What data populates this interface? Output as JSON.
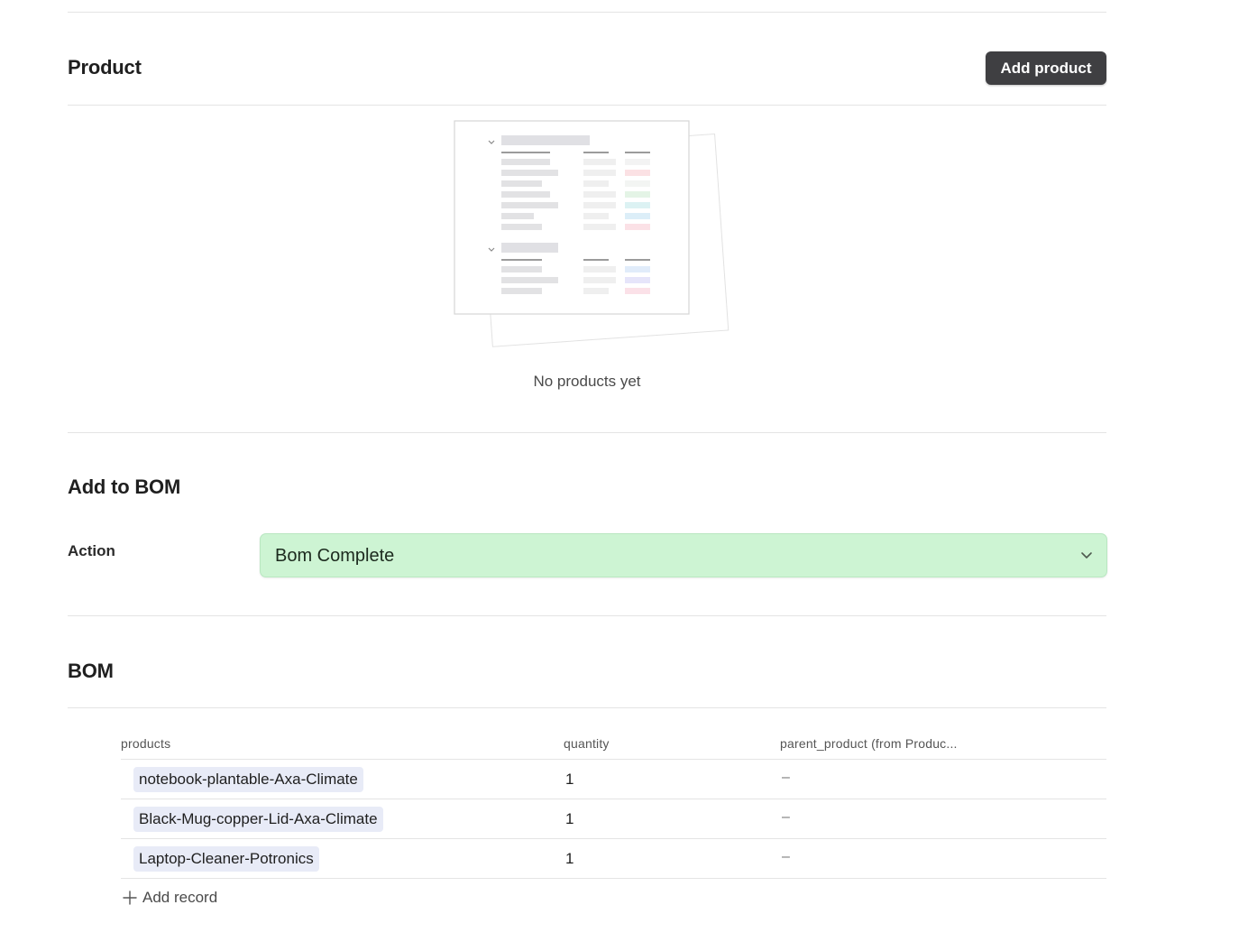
{
  "product_section": {
    "title": "Product",
    "add_button_label": "Add product",
    "empty_state_text": "No products yet",
    "illustration_icon": "empty-table-illustration"
  },
  "bom_action_section": {
    "title": "Add to BOM",
    "action_label": "Action",
    "action_value": "Bom Complete",
    "action_color": "#cdf4d3"
  },
  "bom_section": {
    "title": "BOM",
    "columns": [
      "products",
      "quantity",
      "parent_product (from Produc..."
    ],
    "rows": [
      {
        "product": "notebook-plantable-Axa-Climate",
        "quantity": "1",
        "parent": "–"
      },
      {
        "product": "Black-Mug-copper-Lid-Axa-Climate",
        "quantity": "1",
        "parent": "–"
      },
      {
        "product": "Laptop-Cleaner-Potronics",
        "quantity": "1",
        "parent": "–"
      }
    ],
    "add_record_label": "Add record",
    "chip_color": "#e8ebf7"
  }
}
